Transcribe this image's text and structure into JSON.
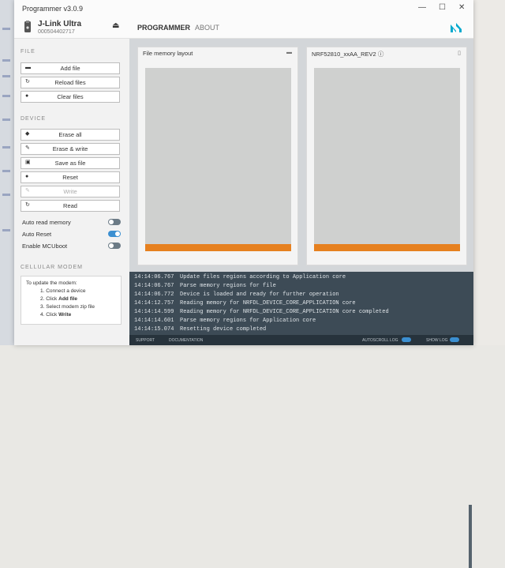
{
  "window": {
    "title": "Programmer v3.0.9",
    "controls": {
      "minimize": "—",
      "maximize": "☐",
      "close": "✕"
    }
  },
  "device": {
    "name": "J-Link Ultra",
    "serial": "000504402717",
    "eject_icon": "eject-icon"
  },
  "tabs": [
    {
      "label": "PROGRAMMER",
      "active": true
    },
    {
      "label": "ABOUT",
      "active": false
    }
  ],
  "brand": {
    "logo": "nordic-logo",
    "color": "#00a9ce"
  },
  "sidebar": {
    "file_section": "FILE",
    "file_buttons": [
      {
        "label": "Add file",
        "icon": "folder-icon"
      },
      {
        "label": "Reload files",
        "icon": "reload-icon"
      },
      {
        "label": "Clear files",
        "icon": "clear-icon"
      }
    ],
    "device_section": "DEVICE",
    "device_buttons": [
      {
        "label": "Erase all",
        "icon": "eraser-icon",
        "disabled": false
      },
      {
        "label": "Erase & write",
        "icon": "pencil-icon",
        "disabled": false
      },
      {
        "label": "Save as file",
        "icon": "save-icon",
        "disabled": false
      },
      {
        "label": "Reset",
        "icon": "dot-icon",
        "disabled": false
      },
      {
        "label": "Write",
        "icon": "pencil-icon",
        "disabled": true
      },
      {
        "label": "Read",
        "icon": "refresh-icon",
        "disabled": false
      }
    ],
    "toggles": [
      {
        "label": "Auto read memory",
        "on": false
      },
      {
        "label": "Auto Reset",
        "on": true
      },
      {
        "label": "Enable MCUboot",
        "on": false
      }
    ],
    "modem_section": "CELLULAR MODEM",
    "modem": {
      "intro": "To update the modem:",
      "step1": "1. Connect a device",
      "step2_prefix": "2. Click ",
      "step2_bold": "Add file",
      "step3": "3. Select modem zip file",
      "step4_prefix": "4. Click ",
      "step4_bold": "Write"
    }
  },
  "panels": {
    "file": {
      "title": "File memory layout",
      "icon": "folder-icon"
    },
    "device": {
      "title": "NRF52810_xxAA_REV2",
      "info_icon": "info-icon",
      "icon": "trash-icon"
    }
  },
  "colors": {
    "accent": "#3b8fd1",
    "memory_region": "#e6801f",
    "log_bg": "#3d4b56"
  },
  "log": [
    {
      "time": "14:14:06.767",
      "msg": "Update files regions according to Application core"
    },
    {
      "time": "14:14:06.767",
      "msg": "Parse memory regions for file"
    },
    {
      "time": "14:14:06.772",
      "msg": "Device is loaded and ready for further operation"
    },
    {
      "time": "14:14:12.757",
      "msg": "Reading memory for NRFDL_DEVICE_CORE_APPLICATION core"
    },
    {
      "time": "14:14:14.599",
      "msg": "Reading memory for NRFDL_DEVICE_CORE_APPLICATION core completed"
    },
    {
      "time": "14:14:14.601",
      "msg": "Parse memory regions for Application core"
    },
    {
      "time": "14:14:15.074",
      "msg": "Resetting device completed"
    }
  ],
  "footer": {
    "link1": "SUPPORT",
    "link2": "DOCUMENTATION",
    "autoscroll": "AUTOSCROLL LOG",
    "show_log": "SHOW LOG"
  }
}
